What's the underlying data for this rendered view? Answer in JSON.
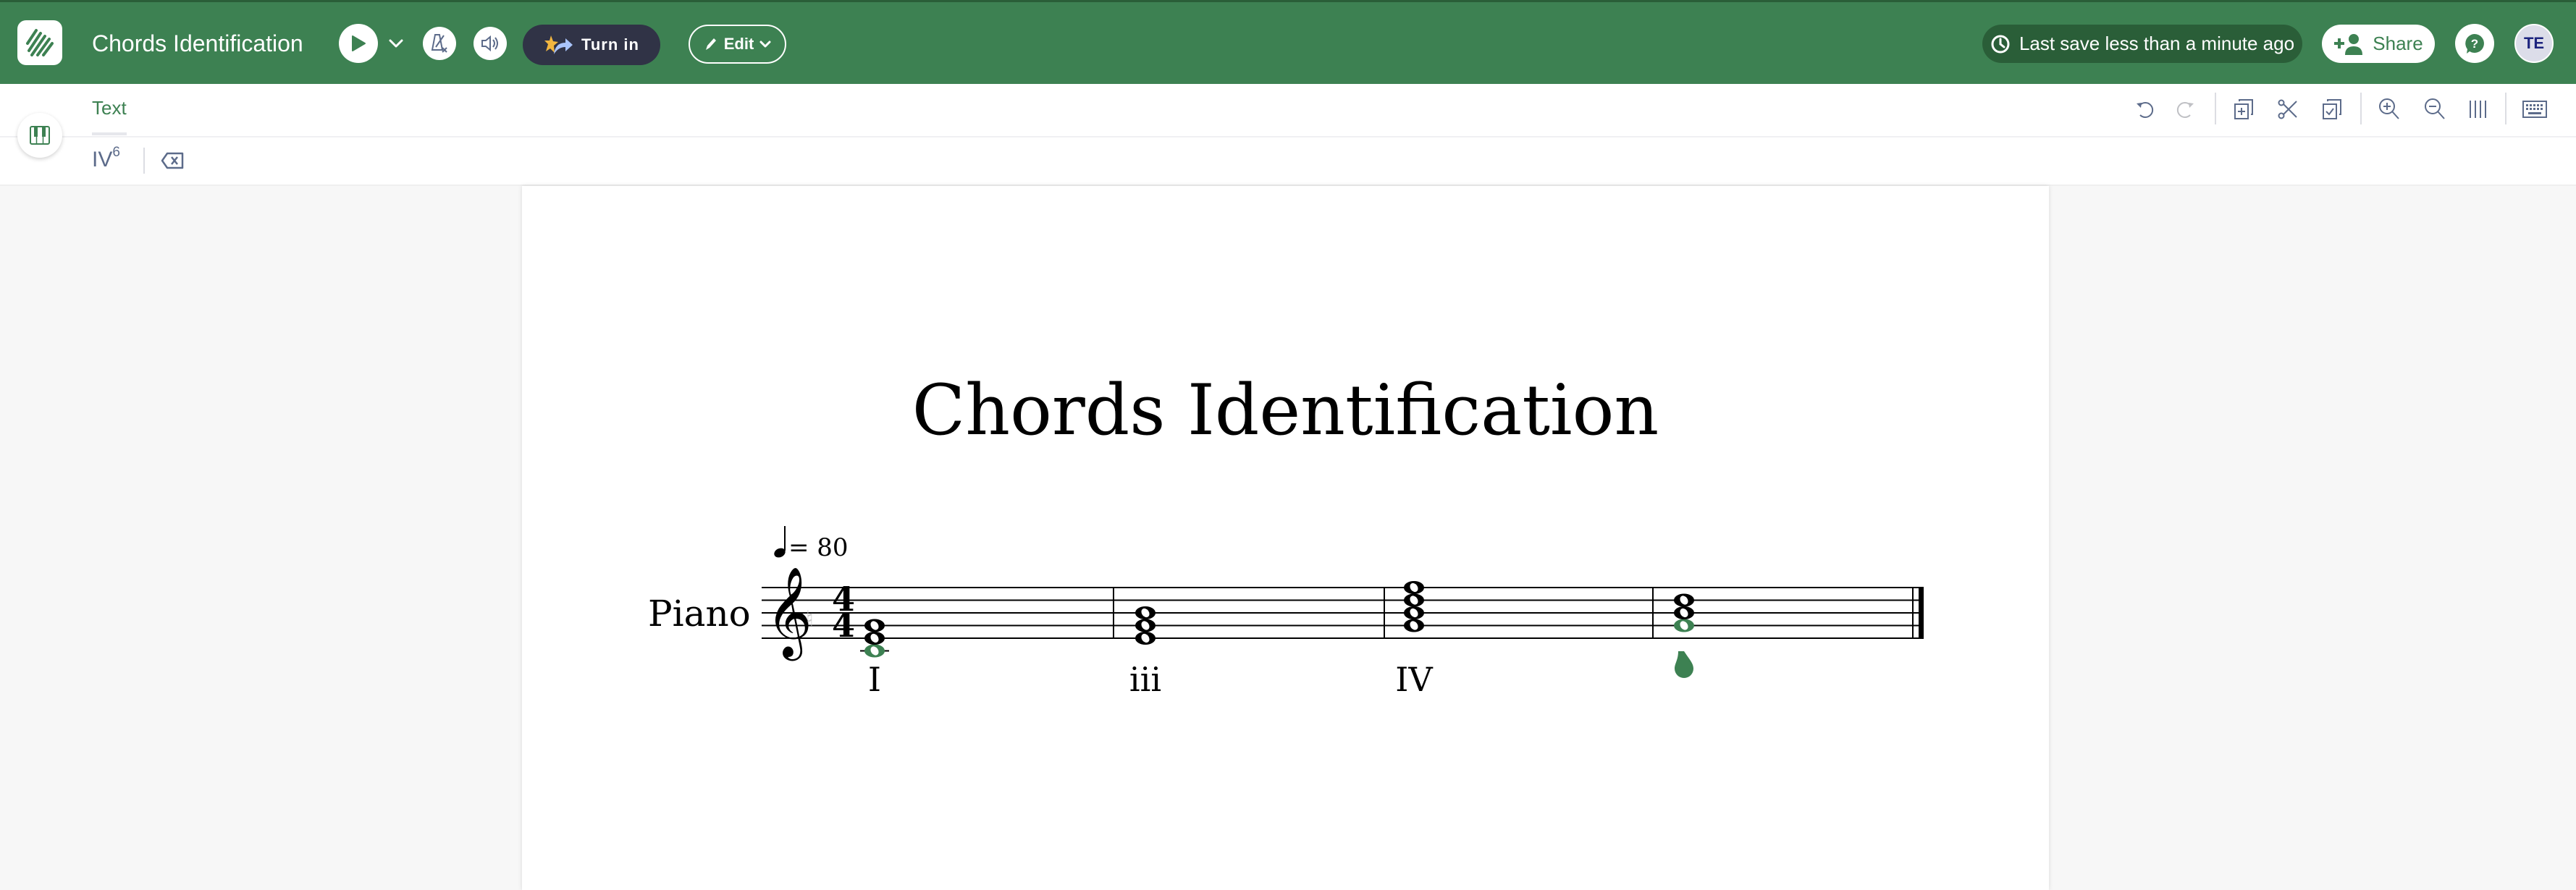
{
  "header": {
    "app_title": "Chords Identification",
    "turn_in_label": "Turn in",
    "edit_label": "Edit",
    "save_status": "Last save less than a minute ago",
    "share_label": "Share",
    "avatar_initials": "TE",
    "colors": {
      "brand_green": "#3d8152",
      "dark_green": "#2a5e38",
      "turn_in_bg": "#303346",
      "avatar_bg": "#dcdde9"
    }
  },
  "toolbar": {
    "tabs": [
      {
        "label": "Text",
        "active": true
      }
    ],
    "chord_input": {
      "numeral": "IV",
      "figure": "6"
    },
    "icons": [
      "undo",
      "redo",
      "add-part",
      "cut",
      "paste",
      "zoom-in",
      "zoom-out",
      "measure-lines",
      "keyboard"
    ],
    "redo_enabled": false
  },
  "score": {
    "title": "Chords Identification",
    "instrument": "Piano",
    "tempo": {
      "beat": "quarter",
      "bpm_label": "= 80"
    },
    "clef": "treble",
    "time_signature": {
      "top": "4",
      "bottom": "4"
    },
    "measures": [
      {
        "notes": [
          "C4",
          "E4",
          "G4"
        ],
        "highlighted": [
          "C4"
        ],
        "label": "I"
      },
      {
        "notes": [
          "E4",
          "G4",
          "B4"
        ],
        "highlighted": [],
        "label": "iii"
      },
      {
        "notes": [
          "G4",
          "B4",
          "D5",
          "F5"
        ],
        "highlighted": [],
        "label": "IV"
      },
      {
        "notes": [
          "G4",
          "B4",
          "D5"
        ],
        "highlighted": [
          "G4"
        ],
        "label": "",
        "cursor": true
      }
    ],
    "highlight_color": "#3d8152"
  }
}
